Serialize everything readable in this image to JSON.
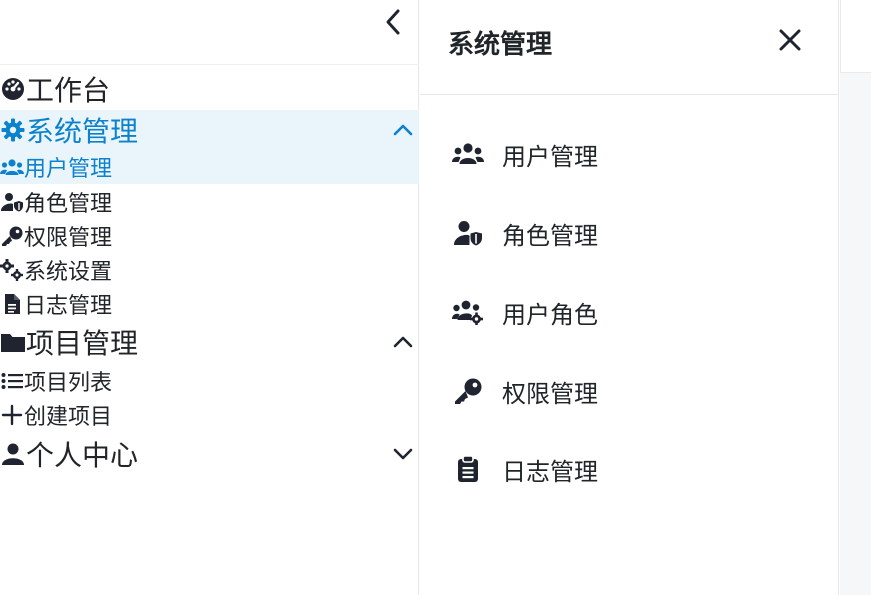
{
  "colors": {
    "accent": "#0d82cc",
    "active_bg": "#eaf4fb",
    "text": "#212529",
    "icon": "#1f2430"
  },
  "sidebar": {
    "collapse_icon": "chevron-left-icon",
    "items": [
      {
        "label": "工作台",
        "icon": "dashboard-icon"
      },
      {
        "label": "系统管理",
        "icon": "gear-icon",
        "expanded": true
      },
      {
        "label": "用户管理",
        "icon": "users-icon",
        "selected": true
      },
      {
        "label": "角色管理",
        "icon": "user-shield-icon"
      },
      {
        "label": "权限管理",
        "icon": "key-icon"
      },
      {
        "label": "系统设置",
        "icon": "gears-icon"
      },
      {
        "label": "日志管理",
        "icon": "file-icon"
      },
      {
        "label": "项目管理",
        "icon": "folder-icon",
        "expanded": true
      },
      {
        "label": "项目列表",
        "icon": "list-icon"
      },
      {
        "label": "创建项目",
        "icon": "plus-icon"
      },
      {
        "label": "个人中心",
        "icon": "user-icon",
        "expanded": false
      }
    ]
  },
  "panel": {
    "title": "系统管理",
    "close_icon": "close-icon",
    "items": [
      {
        "label": "用户管理",
        "icon": "users-icon"
      },
      {
        "label": "角色管理",
        "icon": "user-shield-icon"
      },
      {
        "label": "用户角色",
        "icon": "users-gear-icon"
      },
      {
        "label": "权限管理",
        "icon": "key-icon"
      },
      {
        "label": "日志管理",
        "icon": "clipboard-icon"
      }
    ]
  }
}
